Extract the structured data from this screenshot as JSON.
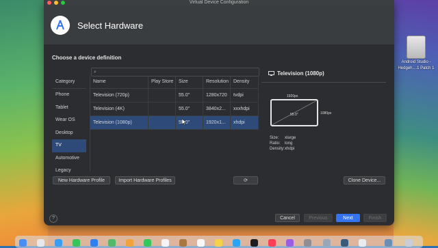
{
  "window": {
    "title": "Virtual Device Configuration"
  },
  "header": {
    "title": "Select Hardware"
  },
  "section": {
    "title": "Choose a device definition"
  },
  "search": {
    "placeholder": ""
  },
  "categories": {
    "header": "Category",
    "items": [
      "Phone",
      "Tablet",
      "Wear OS",
      "Desktop",
      "TV",
      "Automotive",
      "Legacy"
    ],
    "selected": "TV"
  },
  "table": {
    "columns": [
      "Name",
      "Play Store",
      "Size",
      "Resolution",
      "Density"
    ],
    "rows": [
      {
        "name": "Television (720p)",
        "play_store": "",
        "size": "55.0\"",
        "resolution": "1280x720",
        "density": "tvdpi"
      },
      {
        "name": "Television (4K)",
        "play_store": "",
        "size": "55.0\"",
        "resolution": "3840x2...",
        "density": "xxxhdpi"
      },
      {
        "name": "Television (1080p)",
        "play_store": "",
        "size": "55.0\"",
        "resolution": "1920x1...",
        "density": "xhdpi"
      }
    ]
  },
  "buttons": {
    "new_profile": "New Hardware Profile",
    "import_profiles": "Import Hardware Profiles",
    "clone": "Clone Device...",
    "cancel": "Cancel",
    "previous": "Previous",
    "next": "Next",
    "finish": "Finish",
    "help": "?"
  },
  "preview": {
    "title": "Television (1080p)",
    "width_label": "1920px",
    "height_label": "1080px",
    "diagonal": "55.0\"",
    "specs": [
      {
        "key": "Size:",
        "value": "xlarge"
      },
      {
        "key": "Ratio:",
        "value": "long"
      },
      {
        "key": "Density:",
        "value": "xhdpi"
      }
    ]
  },
  "desktop": {
    "drive_label_1": "Android Studio -",
    "drive_label_2": "Hedgeh....1 Patch 1"
  },
  "colors": {
    "accent": "#3574f0",
    "selection": "#2e4a78",
    "window_bg": "#2b2d30"
  }
}
